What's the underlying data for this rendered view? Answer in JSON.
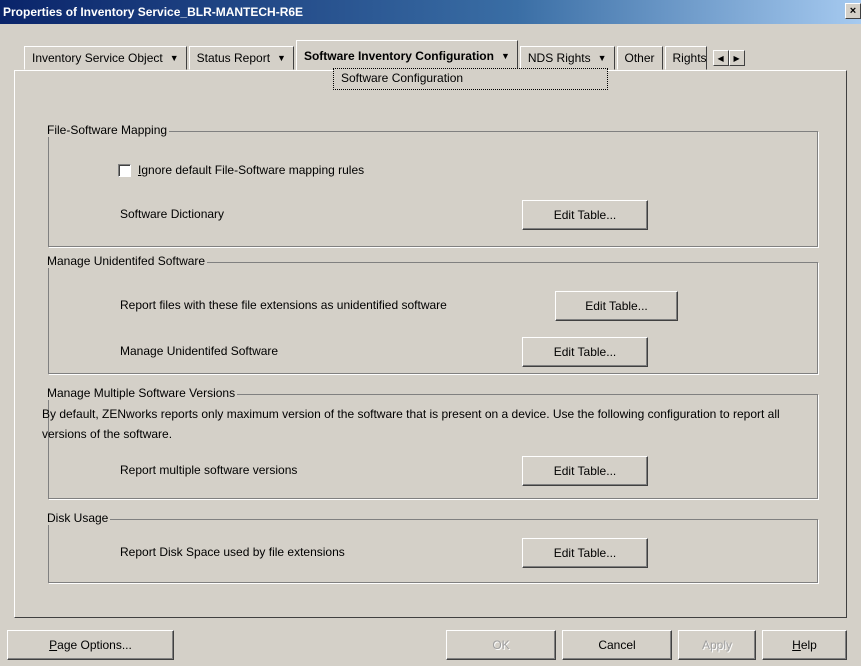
{
  "window": {
    "title": "Properties of Inventory Service_BLR-MANTECH-R6E",
    "close_glyph": "×"
  },
  "tabs": [
    {
      "label": "Inventory Service Object",
      "dropdown": true
    },
    {
      "label": "Status Report",
      "dropdown": true
    },
    {
      "label": "Software Inventory Configuration",
      "dropdown": true,
      "active": true
    },
    {
      "label": "NDS Rights",
      "dropdown": true
    },
    {
      "label": "Other",
      "dropdown": false
    },
    {
      "label": "Rights",
      "dropdown": false
    }
  ],
  "active_subtab": "Software Configuration",
  "sections": {
    "file_mapping": {
      "legend": "File-Software Mapping",
      "checkbox_label_prefix": "I",
      "checkbox_label_rest": "gnore default File-Software mapping rules",
      "checkbox_checked": false,
      "dictionary_label": "Software Dictionary",
      "edit_label": "Edit Table..."
    },
    "unidentified": {
      "legend": "Manage Unidentifed Software",
      "report_label": "Report files with these file extensions as unidentified software",
      "manage_label": "Manage Unidentifed Software",
      "edit_label": "Edit Table..."
    },
    "multiple_versions": {
      "legend": "Manage Multiple Software Versions",
      "description": "By default, ZENworks reports only maximum version of the software that is present on a device. Use the following configuration to report all versions of the software.",
      "report_label": "Report multiple software versions",
      "edit_label": "Edit Table..."
    },
    "disk_usage": {
      "legend": "Disk Usage",
      "report_label": "Report Disk Space used by file extensions",
      "edit_label": "Edit Table..."
    }
  },
  "footer": {
    "page_options_prefix": "P",
    "page_options_rest": "age Options...",
    "ok": "OK",
    "cancel": "Cancel",
    "apply": "Apply",
    "help_prefix": "H",
    "help_rest": "elp",
    "ok_enabled": false,
    "apply_enabled": false
  }
}
